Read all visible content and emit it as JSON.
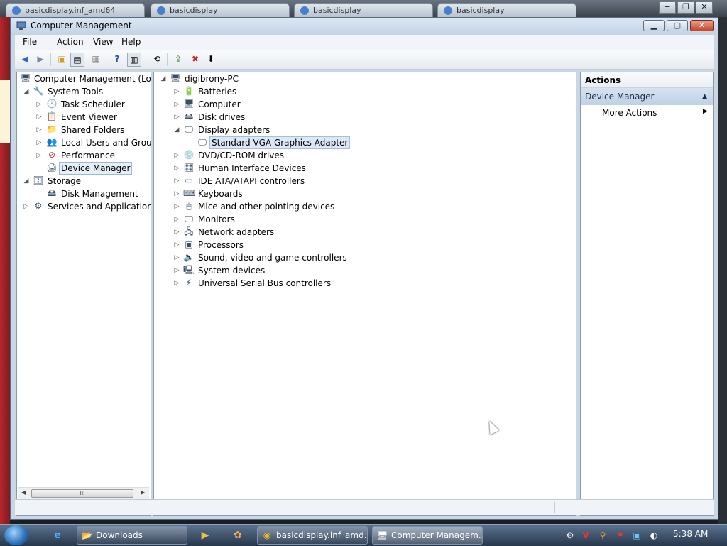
{
  "background_tabs": [
    {
      "label": "basicdisplay.inf_amd64"
    },
    {
      "label": "basicdisplay"
    },
    {
      "label": "basicdisplay"
    },
    {
      "label": "basicdisplay"
    }
  ],
  "window": {
    "title": "Computer Management"
  },
  "menu": [
    "File",
    "Action",
    "View",
    "Help"
  ],
  "left_tree": {
    "root": "Computer Management (Local",
    "system_tools": "System Tools",
    "task_scheduler": "Task Scheduler",
    "event_viewer": "Event Viewer",
    "shared_folders": "Shared Folders",
    "local_users": "Local Users and Groups",
    "performance": "Performance",
    "device_manager": "Device Manager",
    "storage": "Storage",
    "disk_management": "Disk Management",
    "services": "Services and Applications",
    "scroll_grip": "III"
  },
  "device_tree": {
    "root": "digibrony-PC",
    "categories": [
      {
        "label": "Batteries",
        "icon": "battery-icon"
      },
      {
        "label": "Computer",
        "icon": "computer-icon"
      },
      {
        "label": "Disk drives",
        "icon": "disk-drive-icon"
      },
      {
        "label": "Display adapters",
        "icon": "display-adapter-icon"
      },
      {
        "label": "Standard VGA Graphics Adapter",
        "icon": "display-adapter-icon"
      },
      {
        "label": "DVD/CD-ROM drives",
        "icon": "dvd-drive-icon"
      },
      {
        "label": "Human Interface Devices",
        "icon": "hid-icon"
      },
      {
        "label": "IDE ATA/ATAPI controllers",
        "icon": "ide-controller-icon"
      },
      {
        "label": "Keyboards",
        "icon": "keyboard-icon"
      },
      {
        "label": "Mice and other pointing devices",
        "icon": "mouse-icon"
      },
      {
        "label": "Monitors",
        "icon": "monitor-icon"
      },
      {
        "label": "Network adapters",
        "icon": "network-adapter-icon"
      },
      {
        "label": "Processors",
        "icon": "processor-icon"
      },
      {
        "label": "Sound, video and game controllers",
        "icon": "sound-icon"
      },
      {
        "label": "System devices",
        "icon": "system-devices-icon"
      },
      {
        "label": "Universal Serial Bus controllers",
        "icon": "usb-icon"
      }
    ]
  },
  "actions": {
    "header": "Actions",
    "section": "Device Manager",
    "more": "More Actions"
  },
  "taskbar": {
    "downloads": "Downloads",
    "chrome": "basicdisplay.inf_amd...",
    "compmgmt": "Computer Managem...",
    "clock": "5:38 AM"
  },
  "colors": {
    "selection": "#e5eef9",
    "actions_selected": "#bfd1e6",
    "close_button": "#c8452b"
  }
}
